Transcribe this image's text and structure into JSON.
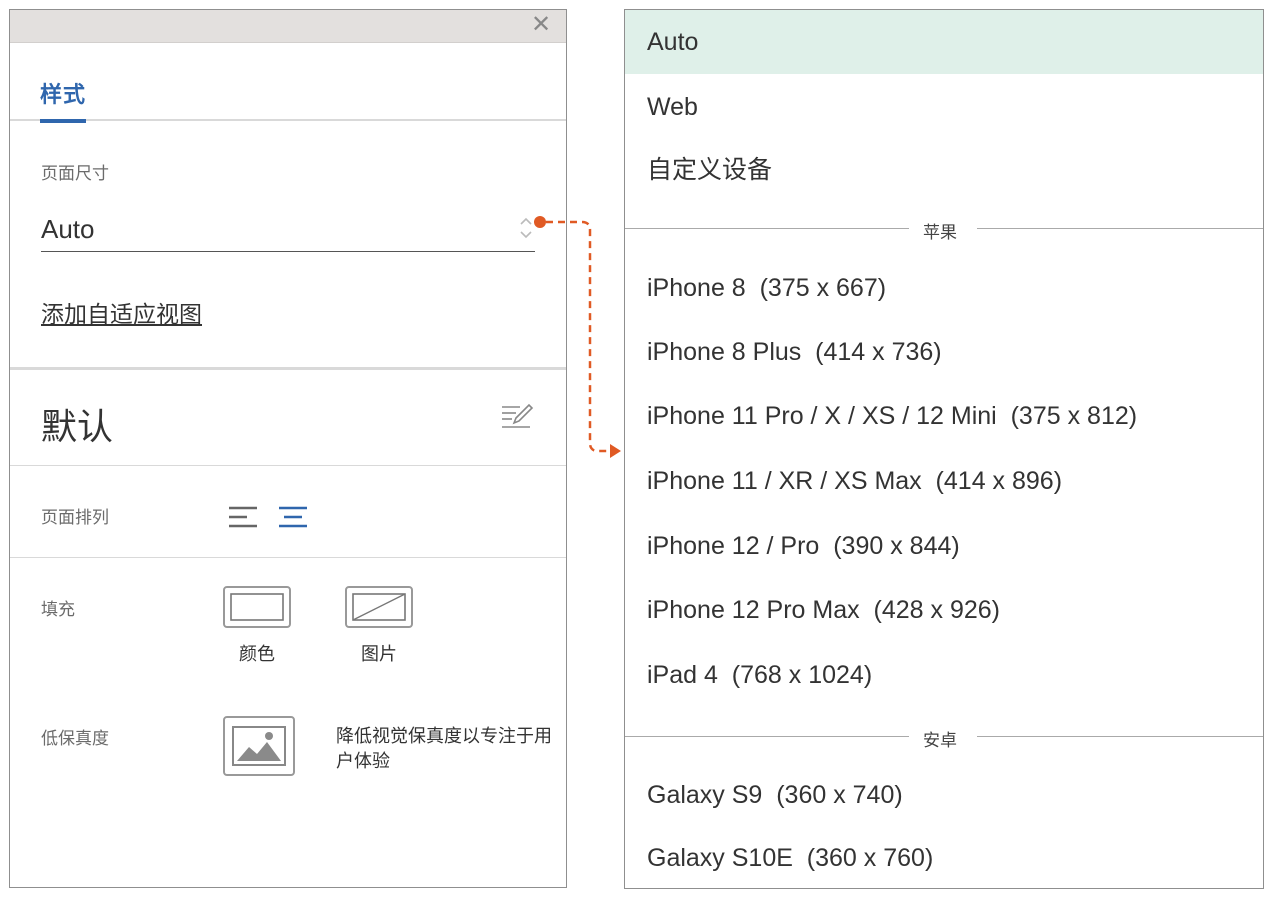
{
  "window": {
    "close_glyph": "✕"
  },
  "tabs": {
    "active_label": "样式"
  },
  "page_size": {
    "label": "页面尺寸",
    "value": "Auto",
    "add_view_link": "添加自适应视图"
  },
  "view": {
    "title": "默认"
  },
  "arrangement": {
    "label": "页面排列",
    "selected": "center"
  },
  "fill": {
    "label": "填充",
    "color_caption": "颜色",
    "image_caption": "图片"
  },
  "fidelity": {
    "label": "低保真度",
    "description": "降低视觉保真度以专注于用户体验"
  },
  "colors": {
    "accent": "#2f66ad",
    "connector": "#e05a24",
    "selected_bg": "#dff0e9"
  },
  "dropdown": {
    "selected": "Auto",
    "options_top": [
      "Auto",
      "Web",
      "自定义设备"
    ],
    "groups": [
      {
        "name": "苹果",
        "items": [
          "iPhone 8  (375 x 667)",
          "iPhone 8 Plus  (414 x 736)",
          "iPhone 11 Pro / X / XS / 12 Mini  (375 x 812)",
          "iPhone 11 / XR / XS Max  (414 x 896)",
          "iPhone 12 / Pro  (390 x 844)",
          "iPhone 12 Pro Max  (428 x 926)",
          "iPad 4  (768 x 1024)"
        ]
      },
      {
        "name": "安卓",
        "items": [
          "Galaxy S9  (360 x 740)",
          "Galaxy S10E  (360 x 760)"
        ]
      }
    ]
  }
}
